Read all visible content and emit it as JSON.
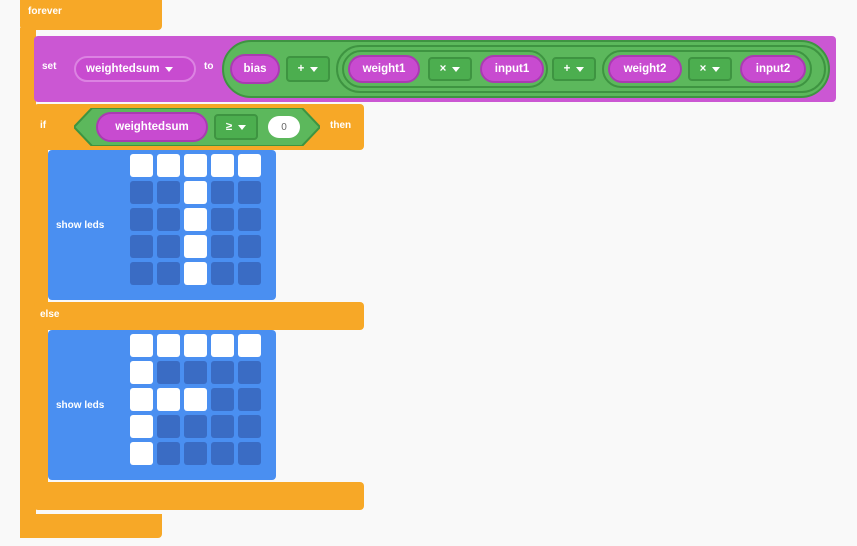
{
  "forever_label": "forever",
  "set_block": {
    "set_label": "set",
    "variable": "weightedsum",
    "to_label": "to",
    "bias": "bias",
    "op_plus_1": "+",
    "weight1": "weight1",
    "op_times_1": "×",
    "input1": "input1",
    "op_plus_2": "+",
    "weight2": "weight2",
    "op_times_2": "×",
    "input2": "input2"
  },
  "if_block": {
    "if_label": "if",
    "variable": "weightedsum",
    "comparator": "≥",
    "value": "0",
    "then_label": "then",
    "else_label": "else"
  },
  "show_leds_1": {
    "label": "show leds",
    "pattern": [
      [
        1,
        1,
        1,
        1,
        1
      ],
      [
        0,
        0,
        1,
        0,
        0
      ],
      [
        0,
        0,
        1,
        0,
        0
      ],
      [
        0,
        0,
        1,
        0,
        0
      ],
      [
        0,
        0,
        1,
        0,
        0
      ]
    ]
  },
  "show_leds_2": {
    "label": "show leds",
    "pattern": [
      [
        1,
        1,
        1,
        1,
        1
      ],
      [
        1,
        0,
        0,
        0,
        0
      ],
      [
        1,
        1,
        1,
        0,
        0
      ],
      [
        1,
        0,
        0,
        0,
        0
      ],
      [
        1,
        0,
        0,
        0,
        0
      ]
    ]
  },
  "colors": {
    "control": "#f7a827",
    "variables": "#cb57d3",
    "math": "#5cb85c",
    "basic": "#4a8ff1",
    "canvas": "#f9f9f9"
  }
}
